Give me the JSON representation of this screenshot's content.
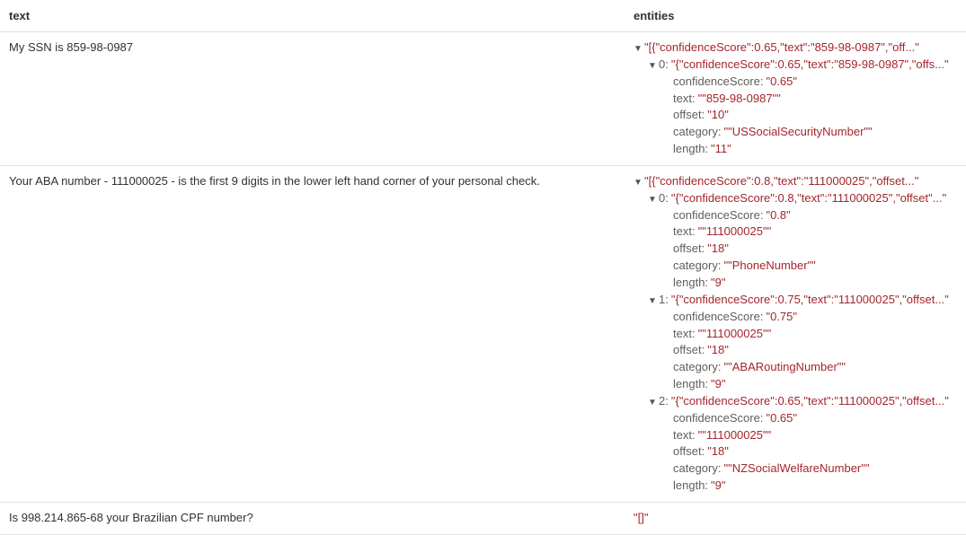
{
  "columns": {
    "text": "text",
    "entities": "entities"
  },
  "rows": [
    {
      "text": "My SSN is 859-98-0987",
      "entities": {
        "root_preview": "\"[{\"confidenceScore\":0.65,\"text\":\"859-98-0987\",\"off...\"",
        "items": [
          {
            "index": "0",
            "preview": "\"{\"confidenceScore\":0.65,\"text\":\"859-98-0987\",\"offs...\"",
            "fields": [
              {
                "key": "confidenceScore",
                "value": "\"0.65\""
              },
              {
                "key": "text",
                "value": "\"\"859-98-0987\"\""
              },
              {
                "key": "offset",
                "value": "\"10\""
              },
              {
                "key": "category",
                "value": "\"\"USSocialSecurityNumber\"\""
              },
              {
                "key": "length",
                "value": "\"11\""
              }
            ]
          }
        ]
      }
    },
    {
      "text": "Your ABA number - 111000025 - is the first 9 digits in the lower left hand corner of your personal check.",
      "entities": {
        "root_preview": "\"[{\"confidenceScore\":0.8,\"text\":\"111000025\",\"offset...\"",
        "items": [
          {
            "index": "0",
            "preview": "\"{\"confidenceScore\":0.8,\"text\":\"111000025\",\"offset\"...\"",
            "fields": [
              {
                "key": "confidenceScore",
                "value": "\"0.8\""
              },
              {
                "key": "text",
                "value": "\"\"111000025\"\""
              },
              {
                "key": "offset",
                "value": "\"18\""
              },
              {
                "key": "category",
                "value": "\"\"PhoneNumber\"\""
              },
              {
                "key": "length",
                "value": "\"9\""
              }
            ]
          },
          {
            "index": "1",
            "preview": "\"{\"confidenceScore\":0.75,\"text\":\"111000025\",\"offset...\"",
            "fields": [
              {
                "key": "confidenceScore",
                "value": "\"0.75\""
              },
              {
                "key": "text",
                "value": "\"\"111000025\"\""
              },
              {
                "key": "offset",
                "value": "\"18\""
              },
              {
                "key": "category",
                "value": "\"\"ABARoutingNumber\"\""
              },
              {
                "key": "length",
                "value": "\"9\""
              }
            ]
          },
          {
            "index": "2",
            "preview": "\"{\"confidenceScore\":0.65,\"text\":\"111000025\",\"offset...\"",
            "fields": [
              {
                "key": "confidenceScore",
                "value": "\"0.65\""
              },
              {
                "key": "text",
                "value": "\"\"111000025\"\""
              },
              {
                "key": "offset",
                "value": "\"18\""
              },
              {
                "key": "category",
                "value": "\"\"NZSocialWelfareNumber\"\""
              },
              {
                "key": "length",
                "value": "\"9\""
              }
            ]
          }
        ]
      }
    },
    {
      "text": "Is 998.214.865-68 your Brazilian CPF number?",
      "entities": {
        "root_preview": "\"[]\"",
        "items": []
      }
    }
  ]
}
